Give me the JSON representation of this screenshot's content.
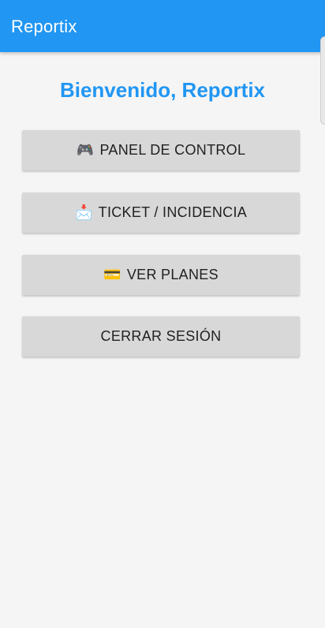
{
  "app_bar": {
    "title": "Reportix",
    "color": "#2196f3"
  },
  "welcome": {
    "text": "Bienvenido, Reportix",
    "color": "#2196f3"
  },
  "buttons": [
    {
      "label": "PANEL DE CONTROL",
      "icon": "gamepad-icon",
      "glyph": "🎮"
    },
    {
      "label": "TICKET / INCIDENCIA",
      "icon": "inbox-tray-icon",
      "glyph": "📩"
    },
    {
      "label": "VER PLANES",
      "icon": "credit-card-icon",
      "glyph": "💳"
    },
    {
      "label": "CERRAR SESIÓN"
    }
  ]
}
